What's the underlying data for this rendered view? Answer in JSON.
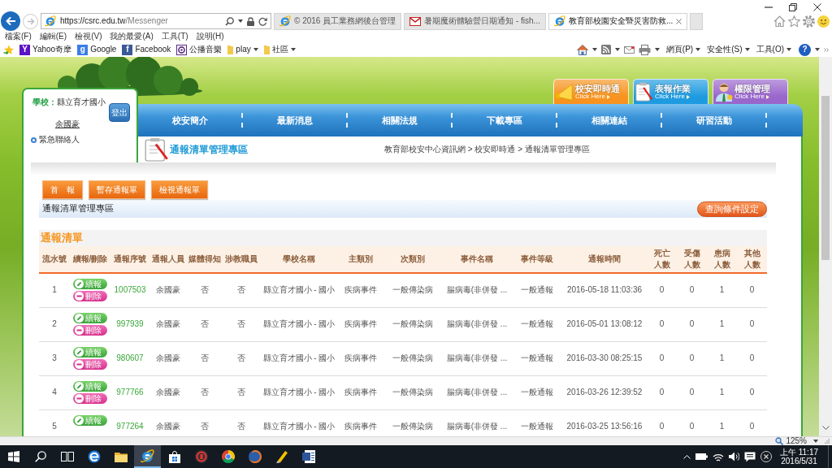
{
  "browser": {
    "address": {
      "host": "https://csrc.edu.tw",
      "path": "/Messenger"
    },
    "tabs": [
      {
        "title": "© 2016 員工業務網後台管理",
        "selected": false
      },
      {
        "title": "暑期魔術體驗營日期通知 - fish...",
        "selected": false
      },
      {
        "title": "教育部校園安全暨災害防救...",
        "selected": true
      }
    ],
    "menu": [
      "檔案(F)",
      "編輯(E)",
      "檢視(V)",
      "我的最愛(A)",
      "工具(T)",
      "說明(H)"
    ],
    "favorites": [
      {
        "kind": "link",
        "icon_text": "Y",
        "label": "Yahoo奇摩"
      },
      {
        "kind": "link",
        "icon_text": "g",
        "label": "Google"
      },
      {
        "kind": "link",
        "icon_text": "f",
        "label": "Facebook"
      },
      {
        "kind": "link",
        "label": "公播音樂"
      },
      {
        "kind": "folder",
        "label": "play"
      },
      {
        "kind": "folder",
        "label": "社區"
      }
    ],
    "commands": [
      "網頁(P)",
      "安全性(S)",
      "工具(O)"
    ],
    "help": "?",
    "zoom": "125%"
  },
  "login": {
    "school_label": "學校：",
    "school": "縣立育才國小",
    "logout": "登出",
    "user": "余國豪",
    "links": [
      "緊急聯絡人"
    ]
  },
  "banners": [
    {
      "title": "校安即時通",
      "subtitle": "Click Here",
      "color": "#f7931e"
    },
    {
      "title": "表報作業",
      "subtitle": "Click Here",
      "color": "#1e9be0"
    },
    {
      "title": "權限管理",
      "subtitle": "Click Here",
      "color": "#9966cc"
    }
  ],
  "nav": [
    "校安簡介",
    "最新消息",
    "相關法規",
    "下載專區",
    "相關連結",
    "研習活動"
  ],
  "page": {
    "title": "通報清單管理專區",
    "breadcrumb": "教育部校安中心資訊網 > 校安即時通 > 通報清單管理專區",
    "buttons": [
      "首　報",
      "暫存通報單",
      "檢視通報單"
    ],
    "bar_title": "通報清單管理專區",
    "query_button": "查詢條件設定"
  },
  "report_list": {
    "title": "通報清單",
    "columns": [
      "流水號",
      "續報/刪除",
      "通報序號",
      "通報人員",
      "媒體得知",
      "涉教職員",
      "學校名稱",
      "主類別",
      "次類別",
      "事件名稱",
      "事件等級",
      "通報時間",
      "死亡人數",
      "受傷人數",
      "患病人數",
      "其他人數"
    ],
    "rows": [
      {
        "no": "1",
        "actions": [
          {
            "kind": "continue",
            "label": "續報"
          },
          {
            "kind": "delete",
            "label": "刪除"
          }
        ],
        "serial": "1007503",
        "reporter": "余國豪",
        "media": "否",
        "staff": "否",
        "school": "縣立育才國小 - 國小",
        "main_type": "疾病事件",
        "sub_type": "一般傳染病",
        "event": "腸病毒(非併發 ...",
        "level": "一般通報",
        "time": "2016-05-18 11:03:36",
        "deaths": "0",
        "injuries": "0",
        "illness": "1",
        "others": "0"
      },
      {
        "no": "2",
        "actions": [
          {
            "kind": "continue",
            "label": "續報"
          },
          {
            "kind": "delete",
            "label": "刪除"
          }
        ],
        "serial": "997939",
        "reporter": "余國豪",
        "media": "否",
        "staff": "否",
        "school": "縣立育才國小 - 國小",
        "main_type": "疾病事件",
        "sub_type": "一般傳染病",
        "event": "腸病毒(非併發 ...",
        "level": "一般通報",
        "time": "2016-05-01 13:08:12",
        "deaths": "0",
        "injuries": "0",
        "illness": "1",
        "others": "0"
      },
      {
        "no": "3",
        "actions": [
          {
            "kind": "continue",
            "label": "續報"
          },
          {
            "kind": "delete",
            "label": "刪除"
          }
        ],
        "serial": "980607",
        "reporter": "余國豪",
        "media": "否",
        "staff": "否",
        "school": "縣立育才國小 - 國小",
        "main_type": "疾病事件",
        "sub_type": "一般傳染病",
        "event": "腸病毒(非併發 ...",
        "level": "一般通報",
        "time": "2016-03-30 08:25:15",
        "deaths": "0",
        "injuries": "0",
        "illness": "1",
        "others": "0"
      },
      {
        "no": "4",
        "actions": [
          {
            "kind": "continue",
            "label": "續報"
          },
          {
            "kind": "delete",
            "label": "刪除"
          }
        ],
        "serial": "977766",
        "reporter": "余國豪",
        "media": "否",
        "staff": "否",
        "school": "縣立育才國小 - 國小",
        "main_type": "疾病事件",
        "sub_type": "一般傳染病",
        "event": "腸病毒(非併發 ...",
        "level": "一般通報",
        "time": "2016-03-26 12:39:52",
        "deaths": "0",
        "injuries": "0",
        "illness": "1",
        "others": "0"
      },
      {
        "no": "5",
        "actions": [
          {
            "kind": "continue",
            "label": "續報"
          }
        ],
        "serial": "977264",
        "reporter": "余國豪",
        "media": "否",
        "staff": "否",
        "school": "縣立育才國小 - 國小",
        "main_type": "疾病事件",
        "sub_type": "一般傳染病",
        "event": "腸病毒(非併發 ...",
        "level": "一般通報",
        "time": "2016-03-25 13:56:16",
        "deaths": "0",
        "injuries": "0",
        "illness": "1",
        "others": "0"
      }
    ]
  },
  "taskbar": {
    "buttons": [
      {
        "selected": false
      },
      {
        "selected": false
      },
      {
        "selected": false
      },
      {
        "selected": false
      },
      {
        "selected": false
      },
      {
        "selected": true
      },
      {
        "selected": false
      },
      {
        "selected": false
      },
      {
        "selected": false
      },
      {
        "selected": false
      },
      {
        "selected": false
      },
      {
        "selected": false
      }
    ],
    "time": "上午 11:17",
    "date": "2016/5/31"
  }
}
